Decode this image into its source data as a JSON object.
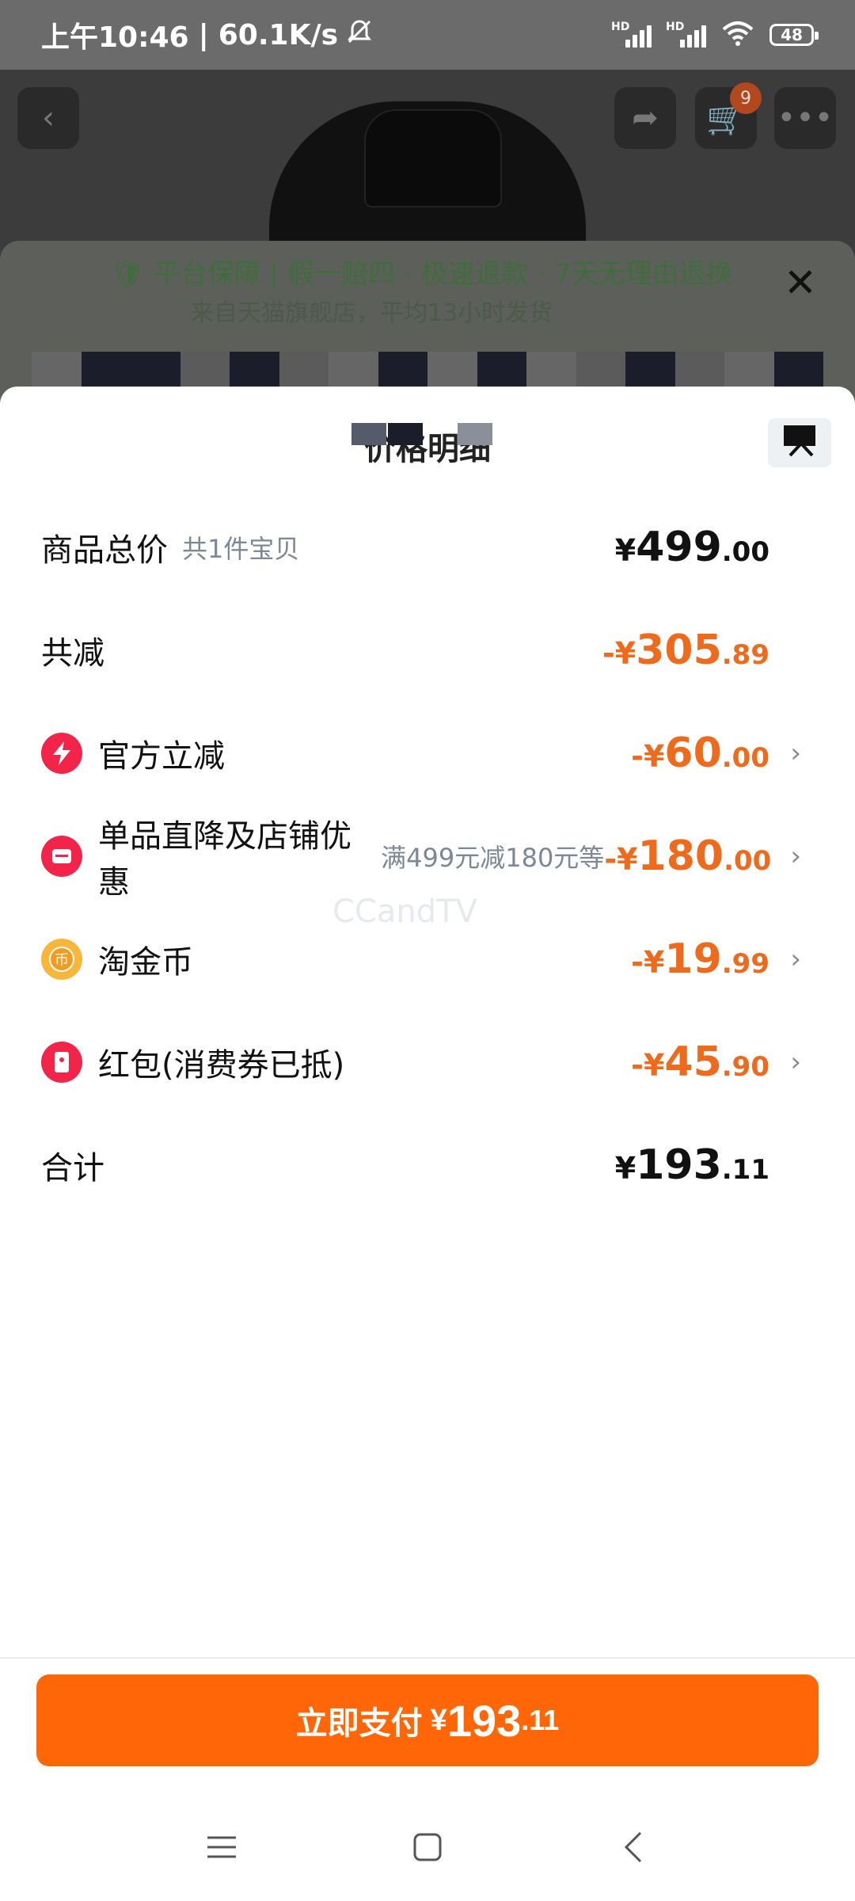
{
  "status_bar": {
    "time": "上午10:46",
    "speed": "60.1K/s",
    "battery": "48",
    "hd": "HD"
  },
  "background": {
    "cart_count": "9",
    "guarantee_line": "平台保障 | 假一赔四 · 极速退款 · 7天无理由退换",
    "guarantee_line2": "来自天猫旗舰店，平均13小时发货"
  },
  "sheet": {
    "title": "价格明细",
    "rows": [
      {
        "label": "商品总价",
        "sub": "共1件宝贝",
        "amount_yen": "¥",
        "amount_int": "499",
        "amount_dec": ".00"
      },
      {
        "label": "共减",
        "amount_yen": "-¥",
        "amount_int": "305",
        "amount_dec": ".89"
      },
      {
        "label": "官方立减",
        "icon": "lightning-icon",
        "amount_yen": "-¥",
        "amount_int": "60",
        "amount_dec": ".00"
      },
      {
        "label": "单品直降及店铺优惠",
        "icon": "shop-coupon-icon",
        "desc": "满499元减180元等",
        "amount_yen": "-¥",
        "amount_int": "180",
        "amount_dec": ".00"
      },
      {
        "label": "淘金币",
        "icon": "gold-coin-icon",
        "amount_yen": "-¥",
        "amount_int": "19",
        "amount_dec": ".99"
      },
      {
        "label": "红包(消费券已抵)",
        "icon": "red-packet-icon",
        "amount_yen": "-¥",
        "amount_int": "45",
        "amount_dec": ".90"
      },
      {
        "label": "合计",
        "amount_yen": "¥",
        "amount_int": "193",
        "amount_dec": ".11"
      }
    ],
    "watermark": "CCandTV"
  },
  "pay_button": {
    "label": "立即支付",
    "yen": "¥",
    "int": "193",
    "dec": ".11"
  },
  "colors": {
    "accent_orange": "#ff6608",
    "discount_orange": "#ee6a1d",
    "icon_red": "#f2244a"
  }
}
